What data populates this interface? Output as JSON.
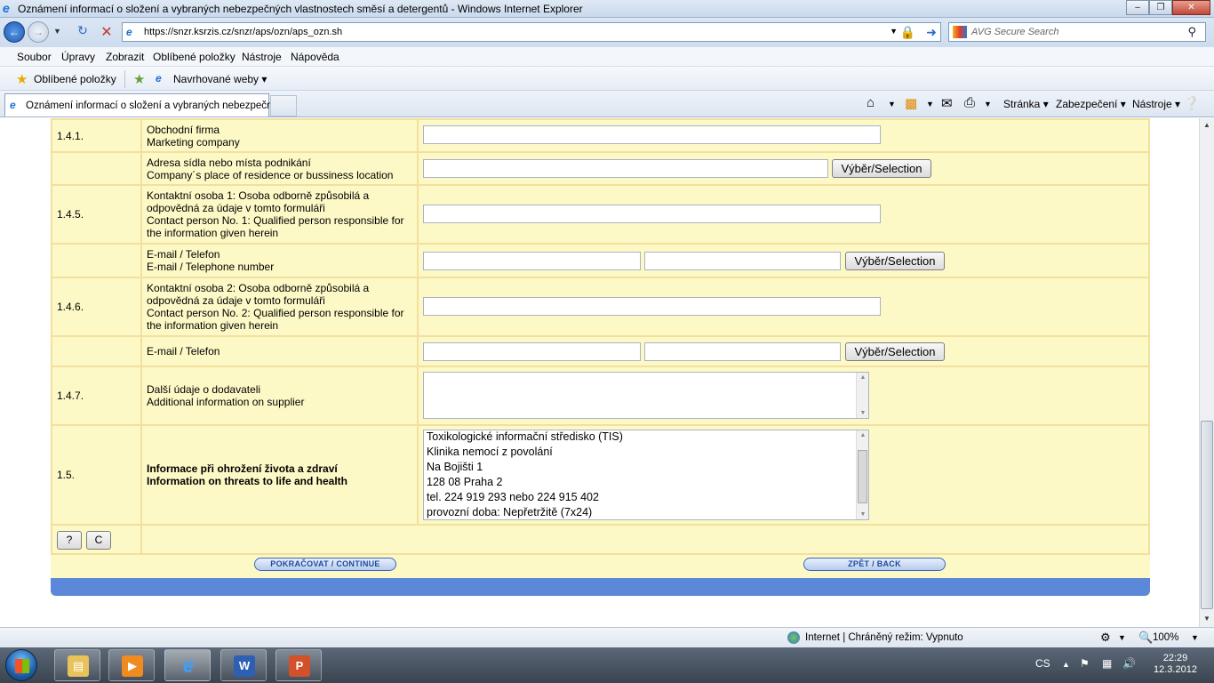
{
  "window": {
    "title": "Oznámení informací o složení a vybraných nebezpečných vlastnostech směsí a detergentů - Windows Internet Explorer"
  },
  "address": {
    "url": "https://snzr.ksrzis.cz/snzr/aps/ozn/aps_ozn.sh",
    "search_placeholder": "AVG Secure Search"
  },
  "menu": {
    "items": [
      "Soubor",
      "Úpravy",
      "Zobrazit",
      "Oblíbené položky",
      "Nástroje",
      "Nápověda"
    ]
  },
  "favbar": {
    "favorites_label": "Oblíbené položky",
    "suggested_label": "Navrhované weby"
  },
  "tab": {
    "title": "Oznámení informací o složení a vybraných nebezpečn..."
  },
  "commandbar": {
    "page": "Stránka",
    "safety": "Zabezpečení",
    "tools": "Nástroje"
  },
  "form": {
    "rows": [
      {
        "num": "1.4.1.",
        "label_cz": "Obchodní firma",
        "label_en": "Marketing company"
      },
      {
        "num": "",
        "label_cz": "Adresa sídla nebo místa podnikání",
        "label_en": "Company´s place of residence or bussiness location"
      },
      {
        "num": "1.4.5.",
        "label_1": "Kontaktní osoba 1: Osoba odborně způsobilá a",
        "label_2": "odpovědná za údaje v tomto formuláři",
        "label_3": "Contact person No. 1: Qualified person responsible for",
        "label_4": "the information given herein"
      },
      {
        "num": "",
        "label_cz": "E-mail / Telefon",
        "label_en": "E-mail / Telephone number"
      },
      {
        "num": "1.4.6.",
        "label_1": "Kontaktní osoba 2: Osoba odborně způsobilá a",
        "label_2": "odpovědná za údaje v tomto formuláři",
        "label_3": "Contact person No. 2: Qualified person responsible for",
        "label_4": "the information given herein"
      },
      {
        "num": "",
        "label_cz": "E-mail / Telefon"
      },
      {
        "num": "1.4.7.",
        "label_cz": "Další údaje o dodavateli",
        "label_en": "Additional information on supplier"
      },
      {
        "num": "1.5.",
        "label_cz": "Informace při ohrožení života a zdraví",
        "label_en": "Information on threats to life and health"
      }
    ],
    "selection_button": "Výběr/Selection",
    "tis_lines": [
      "Toxikologické informační středisko (TIS)",
      "Klinika nemocí z povolání",
      "Na Bojišti 1",
      "128 08  Praha 2",
      "tel. 224 919 293 nebo 224 915 402",
      "provozní doba: Nepřetržitě (7x24)"
    ],
    "help_button": "?",
    "clear_button": "C",
    "continue_button": "POKRAČOVAT / CONTINUE",
    "back_button": "ZPĚT / BACK"
  },
  "status": {
    "zone": "Internet | Chráněný režim: Vypnuto",
    "zoom": "100%"
  },
  "taskbar": {
    "lang": "CS",
    "time": "22:29",
    "date": "12.3.2012"
  }
}
